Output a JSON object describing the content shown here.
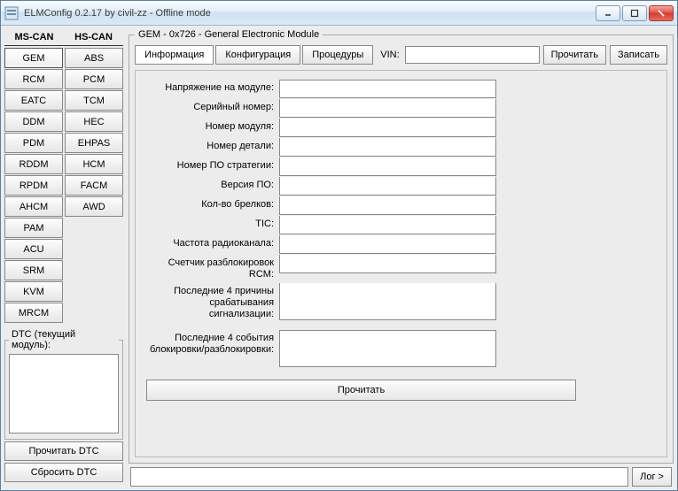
{
  "window": {
    "title": "ELMConfig 0.2.17 by civil-zz - Offline mode"
  },
  "side": {
    "mscan_header": "MS-CAN",
    "hscan_header": "HS-CAN",
    "mscan": [
      "GEM",
      "RCM",
      "EATC",
      "DDM",
      "PDM",
      "RDDM",
      "RPDM",
      "AHCM",
      "PAM",
      "ACU",
      "SRM",
      "KVM",
      "MRCM"
    ],
    "hscan": [
      "ABS",
      "PCM",
      "TCM",
      "HEC",
      "EHPAS",
      "HCM",
      "FACM",
      "AWD"
    ],
    "dtc_legend": "DTC (текущий модуль):",
    "read_dtc": "Прочитать DTC",
    "reset_dtc": "Сбросить DTC"
  },
  "module": {
    "legend": "GEM - 0x726 - General Electronic Module",
    "tabs": {
      "info": "Информация",
      "config": "Конфигурация",
      "proc": "Процедуры"
    },
    "vin_label": "VIN:",
    "vin_value": "",
    "read": "Прочитать",
    "write": "Записать",
    "fields": {
      "voltage": "Напряжение на модуле:",
      "serial": "Серийный номер:",
      "modnum": "Номер модуля:",
      "partnum": "Номер детали:",
      "stratnum": "Номер ПО стратегии:",
      "swver": "Версия ПО:",
      "fobs": "Кол-во брелков:",
      "tic": "TIC:",
      "radiofreq": "Частота радиоканала:",
      "rcmcnt": "Счетчик разблокировок RCM:",
      "alarm4": "Последние 4 причины срабатывания сигнализации:",
      "lock4": "Последние 4 события блокировки/разблокировки:"
    },
    "values": {
      "voltage": "",
      "serial": "",
      "modnum": "",
      "partnum": "",
      "stratnum": "",
      "swver": "",
      "fobs": "",
      "tic": "",
      "radiofreq": "",
      "rcmcnt": "",
      "alarm4": "",
      "lock4": ""
    },
    "read_big": "Прочитать"
  },
  "bottom": {
    "log": "Лог >",
    "status": ""
  }
}
